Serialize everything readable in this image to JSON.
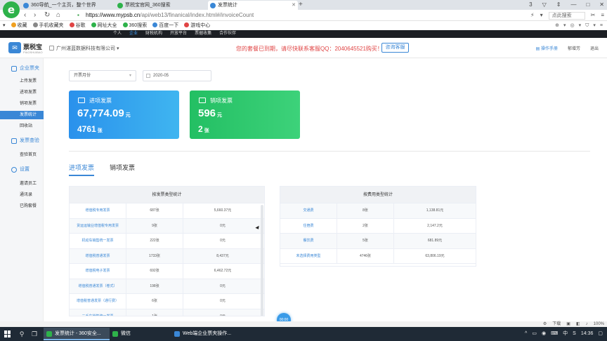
{
  "browser": {
    "tabs": [
      {
        "label": "360导航_一个主页，整个世界",
        "color": "#3a87d6"
      },
      {
        "label": "票税宝官网_360搜索",
        "color": "#2eb24a"
      },
      {
        "label": "发票统计",
        "color": "#3a87d6",
        "active": true
      }
    ],
    "new_tab": "+",
    "window_controls": [
      "3",
      "▽",
      "⇕",
      "—",
      "□",
      "✕"
    ],
    "url_domain": "https://www.mypsb.cn",
    "url_path": "/api/web13/finanical/index.html#/invoiceCount",
    "search_placeholder": "点此搜索",
    "bookmarks": [
      {
        "label": "收藏",
        "color": "#f0a020"
      },
      {
        "label": "手机收藏夹",
        "color": "#888888"
      },
      {
        "label": "谷歌",
        "color": "#e04545"
      },
      {
        "label": "网址大全",
        "color": "#2eb24a"
      },
      {
        "label": "360搜索",
        "color": "#2eb24a"
      },
      {
        "label": "百度一下",
        "color": "#3a87d6"
      },
      {
        "label": "游戏中心",
        "color": "#e04545"
      }
    ],
    "bookmark_right": [
      "⊕",
      "▾",
      "◎",
      "▾",
      "⛉",
      "▾",
      "≡"
    ]
  },
  "site": {
    "topnav": [
      {
        "label": "个人",
        "on": false
      },
      {
        "label": "企业",
        "on": true
      },
      {
        "label": "财税机构",
        "on": false
      },
      {
        "label": "开放平台",
        "on": false
      },
      {
        "label": "票据收集",
        "on": false
      },
      {
        "label": "合作伙伴",
        "on": false
      }
    ],
    "logo_mark": "✉",
    "logo_text": "票税宝",
    "logo_sub": "PIAOSHUIBAO",
    "company": "广州湛蓝数据科技有限公司 ▾",
    "notice": "您的套餐已到期，请尽快联系客服QQ：2040645521购买！",
    "consult_button": "咨询客服",
    "manual": "操作手册",
    "user": "郁增芳",
    "logout": "退出"
  },
  "sidebar": {
    "groups": [
      {
        "label": "企业票夹",
        "items": [
          "上传发票",
          "进项发票",
          "销项发票",
          "发票统计",
          "回收站"
        ]
      },
      {
        "label": "发票查验",
        "items": [
          "查验首页"
        ]
      },
      {
        "label": "设置",
        "items": [
          "邀请员工",
          "通讯录",
          "已购套餐"
        ]
      }
    ],
    "active_item": "发票统计"
  },
  "filters": {
    "period": "开票月份",
    "date": "2020-05",
    "arrow": "▾"
  },
  "cards": {
    "input": {
      "title": "进项发票",
      "amount": "67,774.09",
      "amount_unit": "元",
      "count": "4761",
      "count_unit": "张"
    },
    "output": {
      "title": "销项发票",
      "amount": "596",
      "amount_unit": "元",
      "count": "2",
      "count_unit": "张"
    }
  },
  "content_tabs": {
    "input": "进项发票",
    "output": "销项发票"
  },
  "table_type": {
    "title": "按发票类型统计",
    "rows": [
      {
        "name": "增值税专用发票",
        "count": "687张",
        "amount": "5,660.37元"
      },
      {
        "name": "货运运输业增值税专用发票",
        "count": "9张",
        "amount": "0元"
      },
      {
        "name": "机动车销售统一发票",
        "count": "222张",
        "amount": "0元"
      },
      {
        "name": "增值税普通发票",
        "count": "1733张",
        "amount": "8,437元"
      },
      {
        "name": "增值税电子发票",
        "count": "692张",
        "amount": "6,462.72元"
      },
      {
        "name": "增值税普通发票（卷式）",
        "count": "198张",
        "amount": "0元"
      },
      {
        "name": "增值税普通发票（通行费）",
        "count": "6张",
        "amount": "0元"
      },
      {
        "name": "二手车销售统一发票",
        "count": "1张",
        "amount": "0元"
      }
    ]
  },
  "table_fee": {
    "title": "按费用类型统计",
    "rows": [
      {
        "name": "交通费",
        "count": "8张",
        "amount": "1,138.81元"
      },
      {
        "name": "住宿费",
        "count": "2张",
        "amount": "2,147.2元"
      },
      {
        "name": "餐饮费",
        "count": "5张",
        "amount": "681.89元"
      },
      {
        "name": "未选择费用类型",
        "count": "4746张",
        "amount": "63,806.19元"
      }
    ]
  },
  "timer": "00:00",
  "statusbar": [
    "⚙",
    "下载",
    "▣",
    "◧",
    "♪",
    "100%"
  ],
  "taskbar": {
    "search_icon": "⚲",
    "taskview_icon": "❐",
    "apps": [
      {
        "label": "发票统计 - 360安全...",
        "color": "#2eb24a",
        "active": true
      },
      {
        "label": "微信",
        "color": "#2eb24a",
        "active": false
      },
      {
        "label": "Web端企业票夹操作...",
        "color": "#3a87d6",
        "active": false
      }
    ],
    "tray": [
      "^",
      "▭",
      "◉",
      "⌨",
      "中",
      "S",
      "14:36",
      "▢"
    ]
  }
}
